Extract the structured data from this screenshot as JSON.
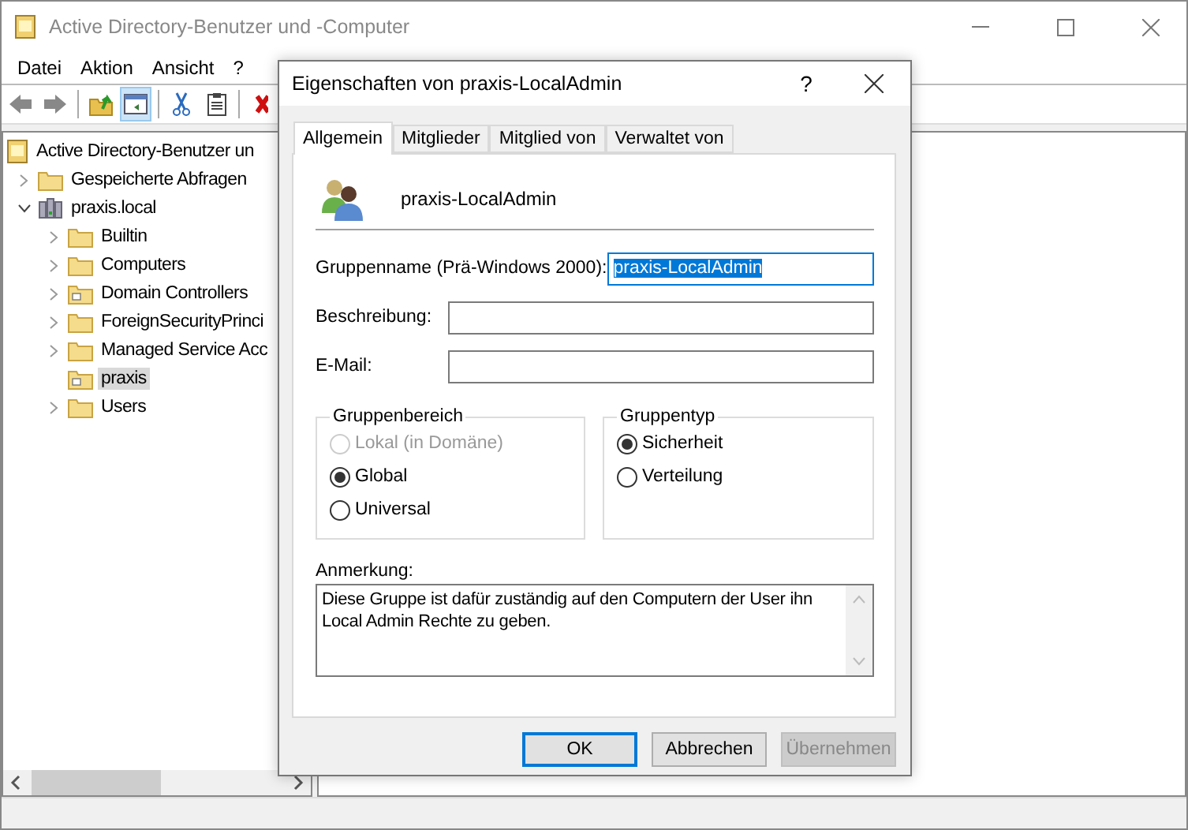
{
  "main_window": {
    "title": "Active Directory-Benutzer und -Computer",
    "menu": [
      "Datei",
      "Aktion",
      "Ansicht",
      "?"
    ],
    "toolbar": [
      {
        "kind": "back"
      },
      {
        "kind": "forward"
      },
      {
        "kind": "separator"
      },
      {
        "kind": "up"
      },
      {
        "kind": "pane",
        "pressed": true
      },
      {
        "kind": "separator"
      },
      {
        "kind": "cut"
      },
      {
        "kind": "paste"
      },
      {
        "kind": "separator"
      },
      {
        "kind": "delete"
      }
    ],
    "tree": [
      {
        "label": "Active Directory-Benutzer un",
        "kind": "root",
        "selected": false,
        "children": [
          {
            "label": "Gespeicherte Abfragen",
            "kind": "folder",
            "selected": false,
            "expandable": true,
            "expanded": false
          },
          {
            "label": "praxis.local",
            "kind": "domain",
            "selected": false,
            "expandable": true,
            "expanded": true,
            "children": [
              {
                "label": "Builtin",
                "kind": "folder",
                "selected": false,
                "expandable": true,
                "expanded": false
              },
              {
                "label": "Computers",
                "kind": "folder",
                "selected": false,
                "expandable": true,
                "expanded": false
              },
              {
                "label": "Domain Controllers",
                "kind": "ou",
                "selected": false,
                "expandable": true,
                "expanded": false
              },
              {
                "label": "ForeignSecurityPrinci",
                "kind": "folder",
                "selected": false,
                "expandable": true,
                "expanded": false
              },
              {
                "label": "Managed Service Acc",
                "kind": "folder",
                "selected": false,
                "expandable": true,
                "expanded": false
              },
              {
                "label": "praxis",
                "kind": "ou",
                "selected": true,
                "expandable": false
              },
              {
                "label": "Users",
                "kind": "folder",
                "selected": false,
                "expandable": true,
                "expanded": false
              }
            ]
          }
        ]
      }
    ]
  },
  "dialog": {
    "title": "Eigenschaften von praxis-LocalAdmin",
    "help": "?",
    "tabs": [
      {
        "label": "Allgemein",
        "selected": true
      },
      {
        "label": "Mitglieder",
        "selected": false
      },
      {
        "label": "Mitglied von",
        "selected": false
      },
      {
        "label": "Verwaltet von",
        "selected": false
      }
    ],
    "object_name": "praxis-LocalAdmin",
    "fields": [
      {
        "label": "Gruppenname (Prä-Windows 2000):",
        "value": "praxis-LocalAdmin",
        "focused": true
      },
      {
        "label": "Beschreibung:",
        "focused": false
      },
      {
        "label": "E-Mail:",
        "focused": false
      }
    ],
    "groups": [
      {
        "title": "Gruppenbereich",
        "options": [
          {
            "label": "Lokal (in Domäne)",
            "selected": false,
            "disabled": true
          },
          {
            "label": "Global",
            "selected": true,
            "disabled": false
          },
          {
            "label": "Universal",
            "selected": false,
            "disabled": false
          }
        ]
      },
      {
        "title": "Gruppentyp",
        "options": [
          {
            "label": "Sicherheit",
            "selected": true,
            "disabled": false
          },
          {
            "label": "Verteilung",
            "selected": false,
            "disabled": false
          }
        ]
      }
    ],
    "note": {
      "label": "Anmerkung:",
      "value": "Diese Gruppe ist dafür zuständig auf den Computern der User ihn\nLocal Admin Rechte zu geben."
    },
    "buttons": [
      {
        "label": "OK",
        "default": true,
        "disabled": false
      },
      {
        "label": "Abbrechen",
        "default": false,
        "disabled": false
      },
      {
        "label": "Übernehmen",
        "default": false,
        "disabled": true
      }
    ]
  }
}
